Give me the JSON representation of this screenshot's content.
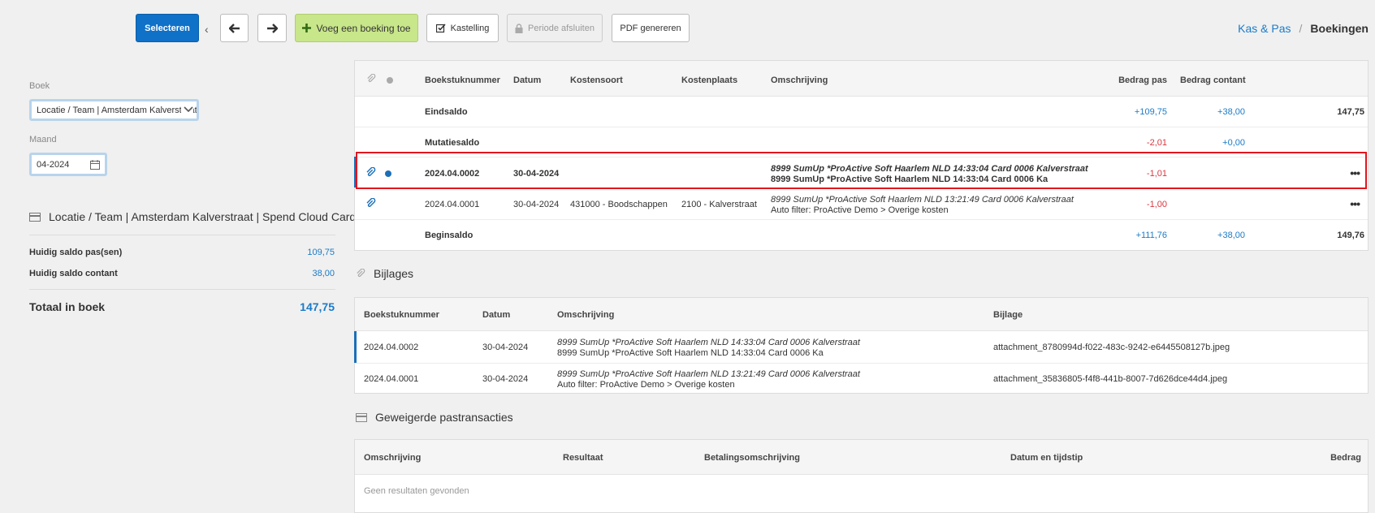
{
  "toolbar": {
    "select_label": "Selecteren",
    "add_label": "Voeg een boeking toe",
    "kastelling_label": "Kastelling",
    "close_period_label": "Periode afsluiten",
    "pdf_label": "PDF genereren"
  },
  "breadcrumb": {
    "parent": "Kas & Pas",
    "separator": "/",
    "current": "Boekingen"
  },
  "filters": {
    "book_label": "Boek",
    "book_value": "Locatie / Team | Amsterdam Kalverstraat",
    "month_label": "Maand",
    "month_value": "04-2024"
  },
  "summary": {
    "account_title": "Locatie / Team | Amsterdam Kalverstraat | Spend Cloud Card",
    "rows": [
      {
        "label": "Huidig saldo pas(sen)",
        "value": "109,75"
      },
      {
        "label": "Huidig saldo contant",
        "value": "38,00"
      }
    ],
    "total_label": "Totaal in boek",
    "total_value": "147,75"
  },
  "bookings": {
    "headers": {
      "number": "Boekstuknummer",
      "date": "Datum",
      "cost_type": "Kostensoort",
      "cost_center": "Kostenplaats",
      "description": "Omschrijving",
      "amount_card": "Bedrag pas",
      "amount_cash": "Bedrag contant"
    },
    "end_balance": {
      "label": "Eindsaldo",
      "card": "+109,75",
      "cash": "+38,00",
      "total": "147,75"
    },
    "mutation_balance": {
      "label": "Mutatiesaldo",
      "card": "-2,01",
      "cash": "+0,00"
    },
    "rows": [
      {
        "number": "2024.04.0002",
        "date": "30-04-2024",
        "cost_type": "",
        "cost_center": "",
        "desc_line1": "8999 SumUp *ProActive Soft Haarlem NLD 14:33:04 Card 0006 Kalverstraat",
        "desc_line2": "8999 SumUp *ProActive Soft Haarlem NLD 14:33:04 Card 0006 Ka",
        "card": "-1,01"
      },
      {
        "number": "2024.04.0001",
        "date": "30-04-2024",
        "cost_type": "431000 - Boodschappen",
        "cost_center": "2100 - Kalverstraat",
        "desc_line1": "8999 SumUp *ProActive Soft Haarlem NLD 13:21:49 Card 0006 Kalverstraat",
        "desc_line2": "Auto filter: ProActive Demo > Overige kosten",
        "card": "-1,00"
      }
    ],
    "begin_balance": {
      "label": "Beginsaldo",
      "card": "+111,76",
      "cash": "+38,00",
      "total": "149,76"
    },
    "more": "•••"
  },
  "attachments": {
    "title": "Bijlages",
    "headers": {
      "number": "Boekstuknummer",
      "date": "Datum",
      "description": "Omschrijving",
      "attachment": "Bijlage"
    },
    "rows": [
      {
        "number": "2024.04.0002",
        "date": "30-04-2024",
        "desc_line1": "8999 SumUp *ProActive Soft Haarlem NLD 14:33:04 Card 0006 Kalverstraat",
        "desc_line2": "8999 SumUp *ProActive Soft Haarlem NLD 14:33:04 Card 0006 Ka",
        "file": "attachment_8780994d-f022-483c-9242-e6445508127b.jpeg"
      },
      {
        "number": "2024.04.0001",
        "date": "30-04-2024",
        "desc_line1": "8999 SumUp *ProActive Soft Haarlem NLD 13:21:49 Card 0006 Kalverstraat",
        "desc_line2": "Auto filter: ProActive Demo > Overige kosten",
        "file": "attachment_35836805-f4f8-441b-8007-7d626dce44d4.jpeg"
      }
    ]
  },
  "declined": {
    "title": "Geweigerde pastransacties",
    "headers": {
      "description": "Omschrijving",
      "result": "Resultaat",
      "payment_description": "Betalingsomschrijving",
      "datetime": "Datum en tijdstip",
      "amount": "Bedrag"
    },
    "empty": "Geen resultaten gevonden"
  },
  "colors": {
    "primary": "#0f71c8",
    "add_green": "#c8e68a",
    "link_blue": "#1b7bc7",
    "negative_red": "#d9363e",
    "highlight_border": "#e0161e"
  },
  "icons": [
    "chevron-left-icon",
    "arrow-left-icon",
    "arrow-right-icon",
    "plus-icon",
    "checkbox-icon",
    "lock-icon",
    "calendar-icon",
    "card-icon",
    "paperclip-icon",
    "dot-icon",
    "more-icon"
  ]
}
